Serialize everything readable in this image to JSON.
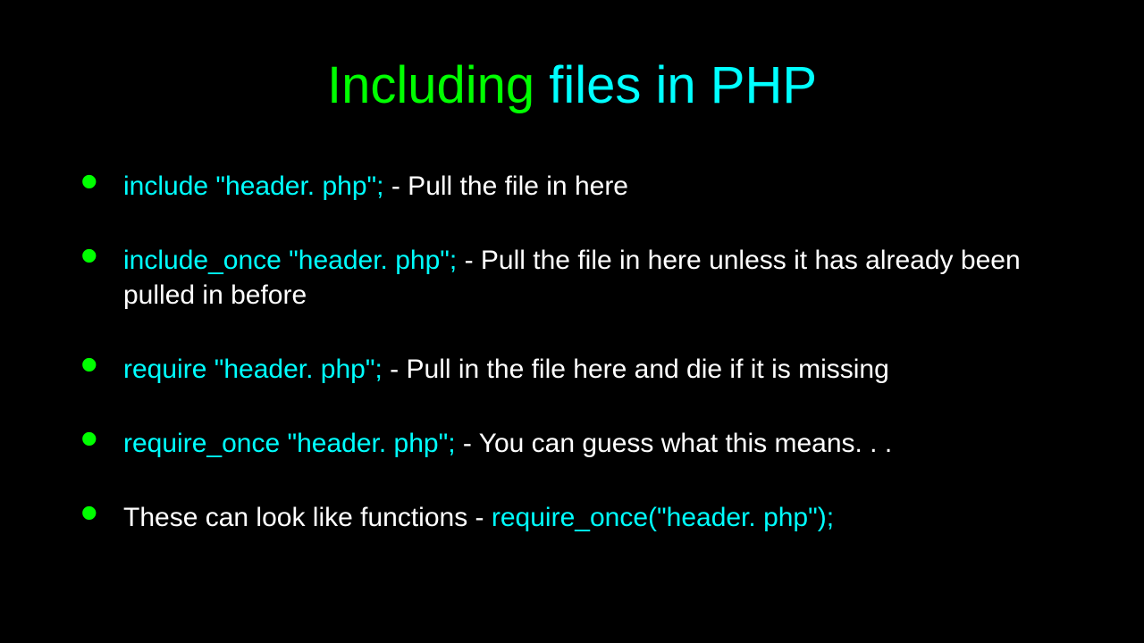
{
  "title": {
    "part1": "Including ",
    "part2": "files in PHP"
  },
  "bullets": [
    {
      "code": "include \"header. php\"; ",
      "text": " - Pull the file in here"
    },
    {
      "code": "include_once \"header. php\"; ",
      "text": " - Pull the file in here unless it has already been pulled in before"
    },
    {
      "code": "require \"header. php\";",
      "text": " - Pull in the file here and die if it is missing"
    },
    {
      "code": "require_once \"header. php\";",
      "text": " - You can guess what this means. . ."
    },
    {
      "pretext": "These can look like functions - ",
      "code": "require_once(\"header. php\");",
      "text": ""
    }
  ]
}
